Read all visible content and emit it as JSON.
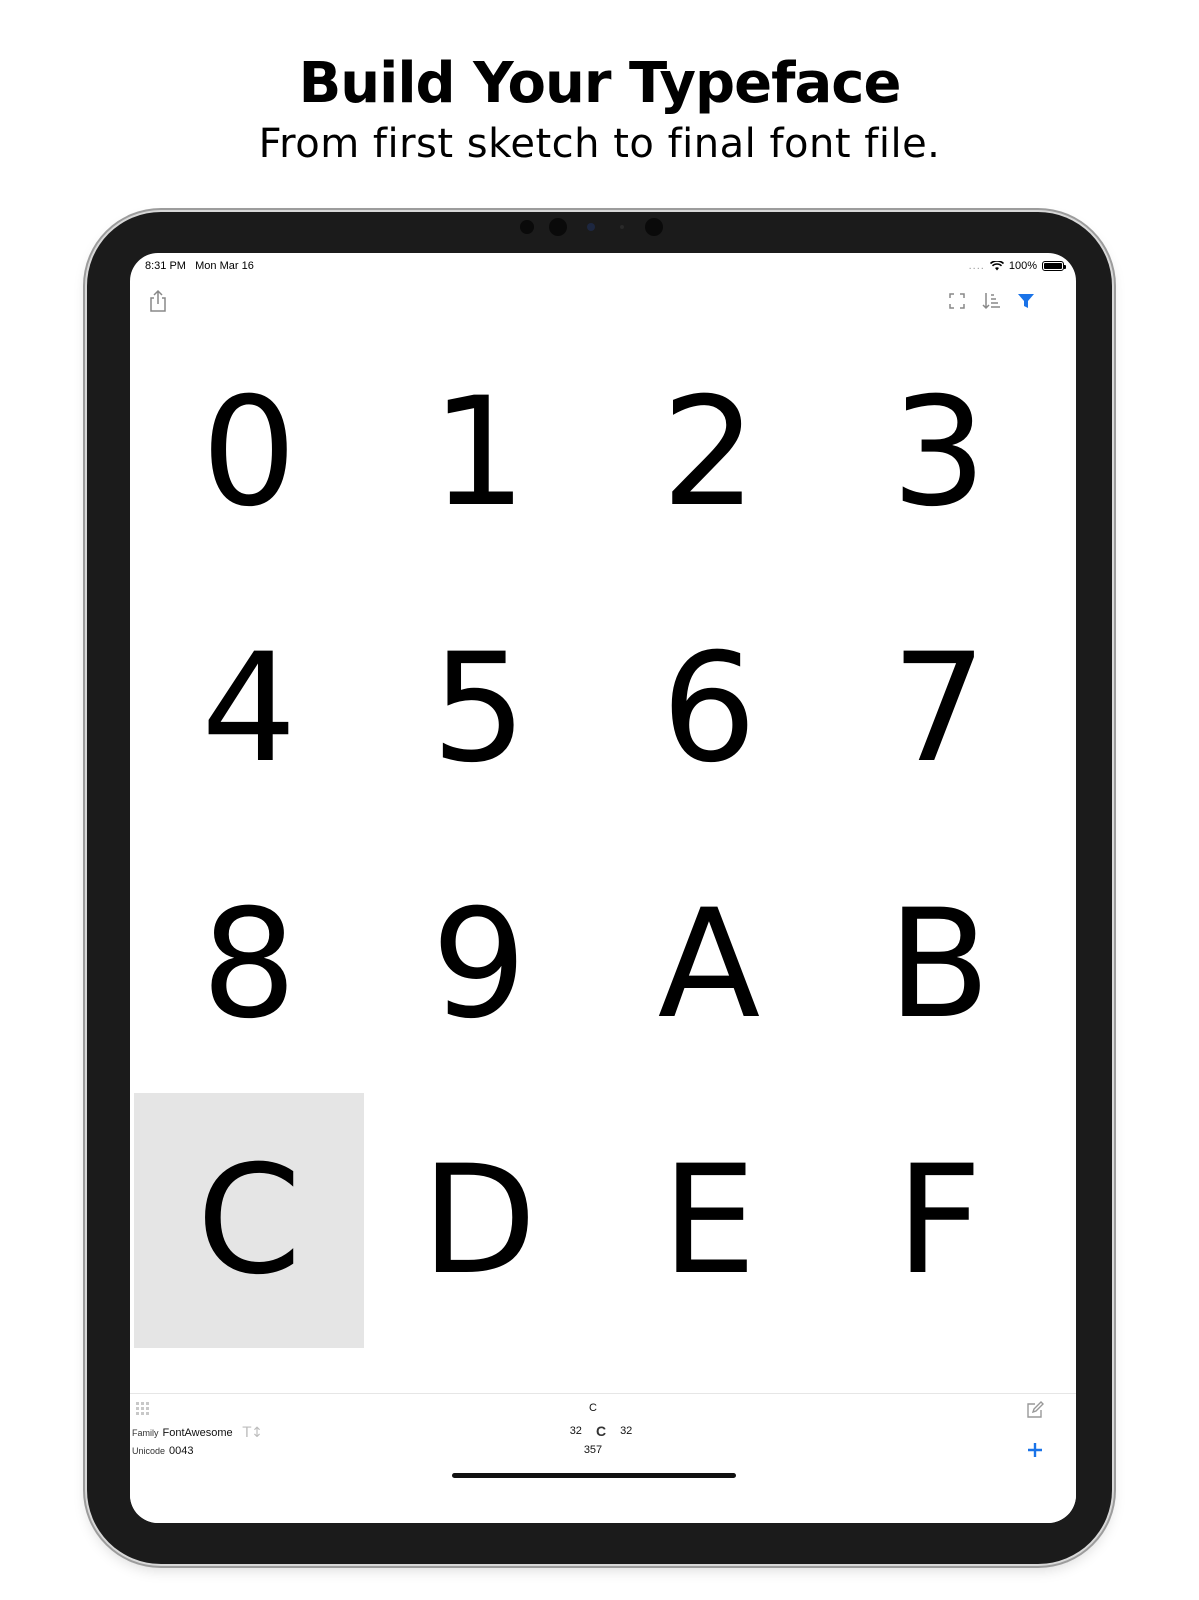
{
  "promo": {
    "headline": "Build Your Typeface",
    "subheadline": "From first sketch to final font file."
  },
  "status_bar": {
    "time": "8:31 PM",
    "date": "Mon Mar 16",
    "battery": "100%"
  },
  "toolbar": {
    "share_icon": "share-icon",
    "fullscreen_icon": "fullscreen-icon",
    "sort_icon": "sort-icon",
    "filter_icon": "filter-icon",
    "accent_color": "#1a73e8"
  },
  "glyph_grid": {
    "glyphs": [
      "0",
      "1",
      "2",
      "3",
      "4",
      "5",
      "6",
      "7",
      "8",
      "9",
      "A",
      "B",
      "C",
      "D",
      "E",
      "F"
    ],
    "selected": "C"
  },
  "info_panel": {
    "glyph_name": "C",
    "family_label": "Family",
    "family_value": "FontAwesome",
    "unicode_label": "Unicode",
    "unicode_value": "0043",
    "left_bearing": "32",
    "preview_glyph": "C",
    "right_bearing": "32",
    "advance_width": "357"
  }
}
